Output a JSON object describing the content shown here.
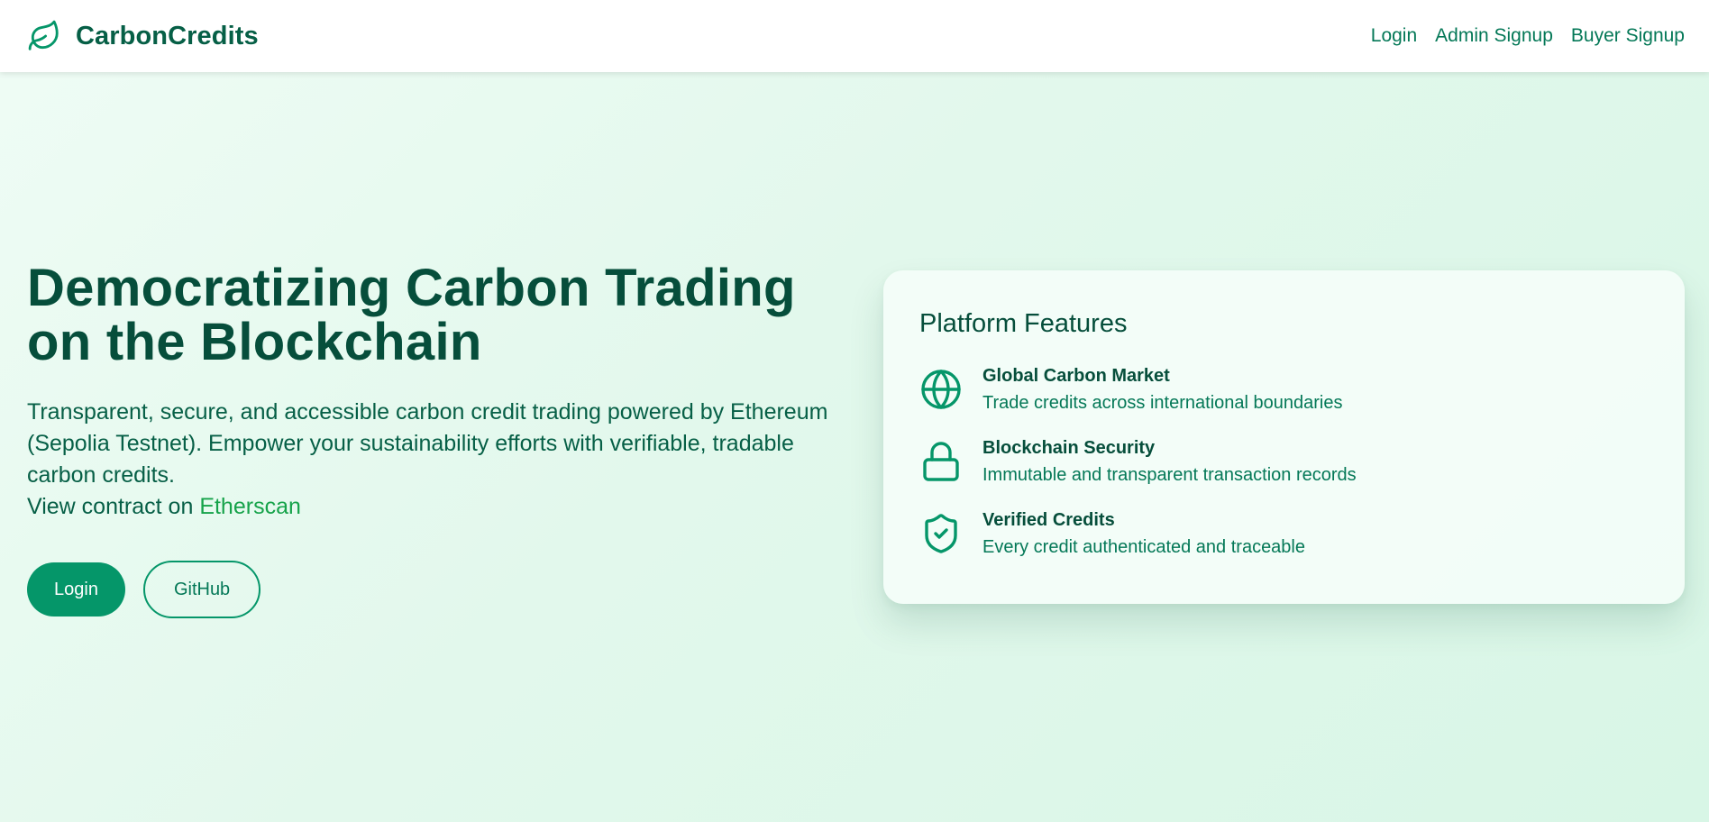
{
  "nav": {
    "brand": "CarbonCredits",
    "links": {
      "login": "Login",
      "admin_signup": "Admin Signup",
      "buyer_signup": "Buyer Signup"
    }
  },
  "hero": {
    "title_line1": "Democratizing Carbon Trading",
    "title_line2": "on the Blockchain",
    "description": "Transparent, secure, and accessible carbon credit trading powered by Ethereum (Sepolia Testnet). Empower your sustainability efforts with verifiable, tradable carbon credits.",
    "contract_prefix": "View contract on ",
    "contract_link": "Etherscan",
    "buttons": {
      "login": "Login",
      "github": "GitHub"
    }
  },
  "features": {
    "title": "Platform Features",
    "items": [
      {
        "icon": "globe-icon",
        "name": "Global Carbon Market",
        "description": "Trade credits across international boundaries"
      },
      {
        "icon": "lock-icon",
        "name": "Blockchain Security",
        "description": "Immutable and transparent transaction records"
      },
      {
        "icon": "shield-check-icon",
        "name": "Verified Credits",
        "description": "Every credit authenticated and traceable"
      }
    ]
  },
  "colors": {
    "accent": "#059669",
    "heading": "#064e3b",
    "link": "#16a34a"
  }
}
